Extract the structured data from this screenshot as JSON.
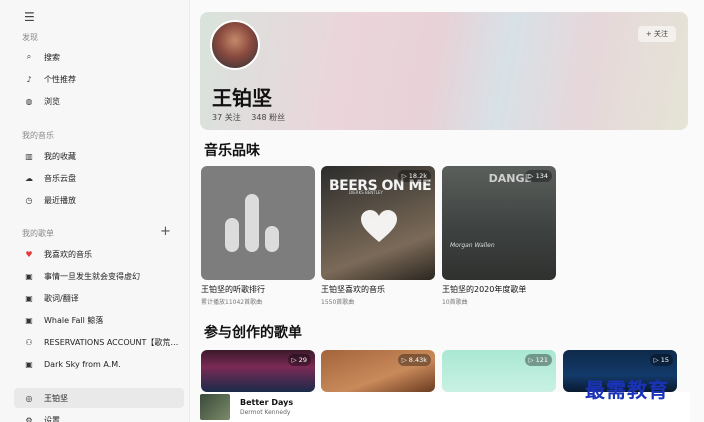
{
  "sidebar": {
    "menu_icon": "hamburger-icon",
    "discover_label": "发现",
    "discover_items": [
      {
        "label": "搜索",
        "icon": "search-icon"
      },
      {
        "label": "个性推荐",
        "icon": "music-note-icon"
      },
      {
        "label": "浏览",
        "icon": "globe-icon"
      }
    ],
    "my_music_label": "我的音乐",
    "my_music_items": [
      {
        "label": "我的收藏",
        "icon": "library-icon"
      },
      {
        "label": "音乐云盘",
        "icon": "cloud-icon"
      },
      {
        "label": "最近播放",
        "icon": "clock-icon"
      }
    ],
    "playlists_label": "我的歌单",
    "add_label": "+",
    "playlists": [
      {
        "label": "我喜欢的音乐",
        "icon": "heart-icon"
      },
      {
        "label": "事情一旦发生就会变得虚幻",
        "icon": "playlist-icon"
      },
      {
        "label": "歌词/翻译",
        "icon": "playlist-icon"
      },
      {
        "label": "Whale Fall 鲸落",
        "icon": "playlist-icon"
      },
      {
        "label": "RESERVATIONS ACCOUNT【歌荒时取用】",
        "icon": "users-icon"
      },
      {
        "label": "Dark Sky from A.M.",
        "icon": "playlist-icon"
      }
    ],
    "bottom_items": [
      {
        "label": "王铂坚",
        "icon": "user-circle-icon"
      },
      {
        "label": "设置",
        "icon": "gear-icon"
      }
    ]
  },
  "now_playing": {
    "title": "Better Days",
    "artist": "Dermot Kennedy"
  },
  "artist": {
    "name": "王铂坚",
    "following": "37 关注",
    "followers": "348 粉丝",
    "follow_button": "+ 关注"
  },
  "section_taste": "音乐品味",
  "taste_cards": [
    {
      "name": "王铂坚的听歌排行",
      "sub": "累计播放11042首歌曲",
      "count": ""
    },
    {
      "name": "王铂坚喜欢的音乐",
      "sub": "1550首歌曲",
      "count": "▷ 18.2k",
      "banner": "BEERS ON ME",
      "banner_top": "DIERKS BENTLEY"
    },
    {
      "name": "王铂坚的2020年度歌单",
      "sub": "10首歌曲",
      "count": "▷ 134",
      "banner": "DANGE",
      "signature": "Morgan Wallen"
    }
  ],
  "section_created": "参与创作的歌单",
  "created_cards": [
    {
      "count": "▷ 29"
    },
    {
      "count": "▷ 8.43k"
    },
    {
      "count": "▷ 121"
    },
    {
      "count": "▷ 15"
    }
  ],
  "watermark": "最需教育",
  "colors": {
    "accent_heart": "#e03a3a",
    "watermark": "#1a33b8"
  }
}
